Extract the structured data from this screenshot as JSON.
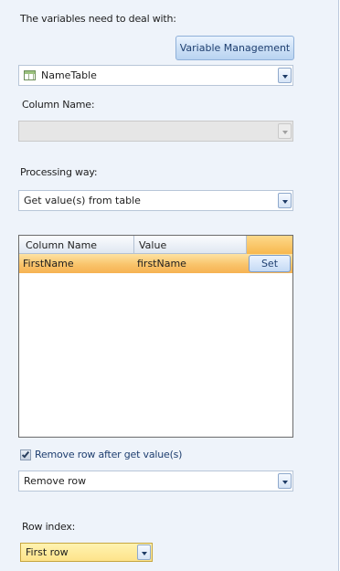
{
  "variables_label": "The variables need to deal with:",
  "variable_management_button": "Variable Management",
  "table_select": {
    "value": "NameTable",
    "icon": "table-icon"
  },
  "column_name_label": "Column Name:",
  "column_name_select": {
    "value": ""
  },
  "processing_way_label": "Processing way:",
  "processing_way_select": {
    "value": "Get value(s) from table"
  },
  "grid": {
    "headers": [
      "Column Name",
      "Value",
      ""
    ],
    "rows": [
      {
        "column_name": "FirstName",
        "value": "firstName",
        "action": "Set"
      }
    ]
  },
  "remove_row_checkbox": {
    "label": "Remove row after get value(s)",
    "checked": true
  },
  "remove_row_select": {
    "value": "Remove row"
  },
  "row_index_label": "Row index:",
  "row_index_select": {
    "value": "First row"
  }
}
